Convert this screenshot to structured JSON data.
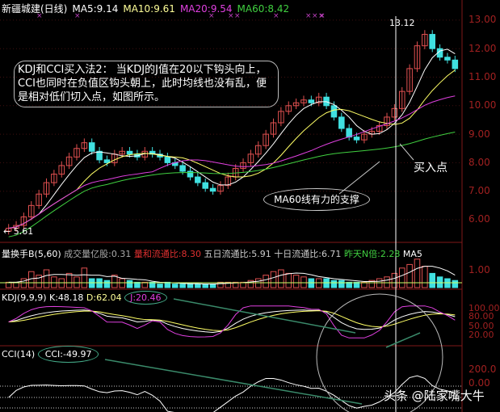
{
  "header": {
    "title": "新疆城建(日线)",
    "ma5": "MA5:9.14",
    "ma10": "MA10:9.61",
    "ma20": "MA20:9.54",
    "ma60": "MA60:8.42"
  },
  "colors": {
    "ma5": "#ffffff",
    "ma10": "#ffff66",
    "ma20": "#e040e0",
    "ma60": "#40d040",
    "up": "#e05050",
    "down": "#40e0e0",
    "axis": "#a02020"
  },
  "annotations": {
    "note": "KDJ和CCI买入法2： 当KDJ的J值在20以下钩头向上，CCI也同时在负值区钩头朝上，此时均线也没有乱，便是相对低们切入点，如图所示。",
    "buy_point": "买入点",
    "ma60_support": "MA60线有力的支撑",
    "high_label": "13.12",
    "low_label": "← 5.61",
    "watermark": "头条 @陆家嘴大牛"
  },
  "volume_panel": {
    "title": "量换手B(5,60)",
    "vol": "成交量亿股:0.31",
    "ratio": "量和流通比:8.30",
    "five": "五日流通比:5.91",
    "ten": "十日流通比:6.71",
    "yday": "昨天N倍:2.28",
    "ma5": "MA5",
    "tick": "1.00"
  },
  "kdj_panel": {
    "title": "KDJ(9,9,9)",
    "k": "K:48.18",
    "d": "D:62.04",
    "j": "J:20.46",
    "ticks": [
      "100.00",
      "80.00",
      "50.00",
      "20.00"
    ]
  },
  "cci_panel": {
    "title": "CCI(14)",
    "cci": "CCI:-49.97",
    "ticks": [
      "200.0",
      "0.00"
    ]
  },
  "chart_data": {
    "type": "candlestick",
    "title": "新疆城建(日线)",
    "ylim": [
      5.5,
      13.5
    ],
    "yticks": [
      "13.00",
      "12.00",
      "11.00",
      "10.00",
      "9.00",
      "8.00",
      "7.00",
      "6.00"
    ],
    "close": [
      5.7,
      5.8,
      6.1,
      6.5,
      6.9,
      7.3,
      7.6,
      7.9,
      8.2,
      8.5,
      8.7,
      8.4,
      8.1,
      8.0,
      8.3,
      8.4,
      8.3,
      8.2,
      8.4,
      8.3,
      8.2,
      8.0,
      7.9,
      7.7,
      7.5,
      7.3,
      7.1,
      7.0,
      7.2,
      7.5,
      7.8,
      8.0,
      8.3,
      8.6,
      9.0,
      9.4,
      9.8,
      10.0,
      10.1,
      10.2,
      10.1,
      10.3,
      10.0,
      9.6,
      9.2,
      8.9,
      8.8,
      9.0,
      9.1,
      9.3,
      9.6,
      9.9,
      10.5,
      11.3,
      12.1,
      12.5,
      12.0,
      11.7,
      11.6,
      11.3
    ],
    "volume": [
      0.3,
      0.3,
      0.5,
      0.9,
      0.7,
      1.0,
      0.6,
      0.5,
      0.8,
      0.6,
      1.1,
      0.5,
      0.5,
      0.4,
      0.7,
      0.5,
      0.4,
      0.3,
      0.3,
      0.3,
      0.2,
      0.3,
      0.2,
      0.2,
      0.2,
      0.2,
      0.2,
      0.2,
      0.3,
      0.3,
      0.3,
      0.3,
      0.4,
      0.5,
      0.7,
      0.9,
      1.0,
      0.8,
      0.7,
      0.6,
      0.5,
      0.5,
      0.5,
      0.4,
      0.4,
      0.3,
      0.3,
      0.3,
      0.4,
      0.5,
      0.6,
      0.8,
      1.1,
      1.3,
      1.6,
      1.2,
      0.8,
      0.6,
      0.5,
      0.4
    ]
  }
}
